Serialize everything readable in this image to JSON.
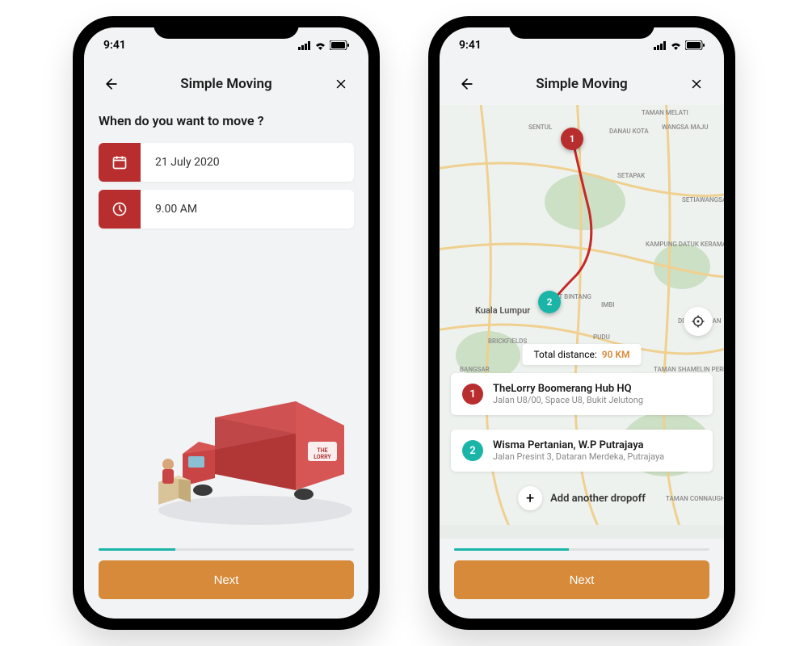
{
  "status": {
    "time": "9:41"
  },
  "header": {
    "title": "Simple Moving"
  },
  "screen1": {
    "question": "When do you want to move ?",
    "date_value": "21 July 2020",
    "time_value": "9.00 AM"
  },
  "screen2": {
    "distance_label": "Total distance:",
    "distance_value": "90 KM",
    "city_label": "Kuala Lumpur",
    "stops": [
      {
        "num": "1",
        "title": "TheLorry Boomerang Hub HQ",
        "subtitle": "Jalan U8/00, Space U8, Bukit Jelutong"
      },
      {
        "num": "2",
        "title": "Wisma Pertanian, W.P Putrajaya",
        "subtitle": "Jalan Presint 3, Dataran Merdeka, Putrajaya"
      }
    ],
    "add_dropoff_label": "Add another dropoff",
    "map_labels": [
      "SENTUL",
      "DANAU KOTA",
      "WANGSA MAJU",
      "SETAPAK",
      "KAMPUNG DATUK KERAMAT",
      "PUDU",
      "IMBI",
      "BRICKFIELDS",
      "TAMAN MELATI",
      "SETIAWANGSA",
      "DESA PANDAN",
      "TAMAN SHAMELIN PERKASA",
      "TAMAN CONNAUGHT",
      "BANGSAR",
      "BUKIT BINTANG"
    ]
  },
  "footer": {
    "next_label": "Next"
  }
}
